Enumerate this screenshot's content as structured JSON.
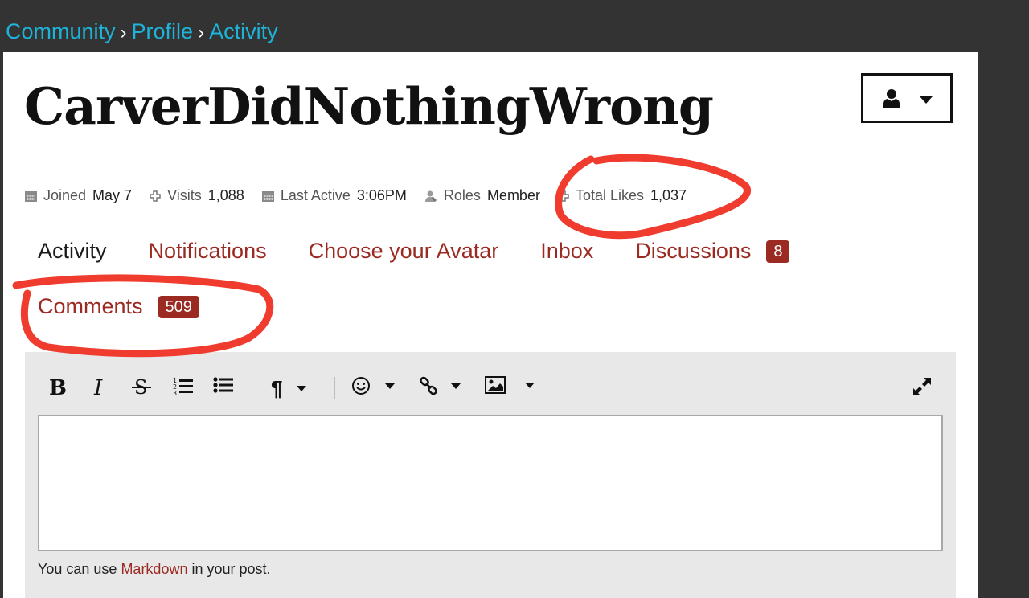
{
  "breadcrumb": {
    "items": [
      "Community",
      "Profile",
      "Activity"
    ],
    "separator": "›"
  },
  "profile": {
    "username": "CarverDidNothingWrong"
  },
  "user_menu": {
    "icon": "user-icon",
    "caret_icon": "caret-down-icon"
  },
  "meta": {
    "joined": {
      "label": "Joined",
      "value": "May 7"
    },
    "visits": {
      "label": "Visits",
      "value": "1,088"
    },
    "last_active": {
      "label": "Last Active",
      "value": "3:06PM"
    },
    "roles": {
      "label": "Roles",
      "value": "Member"
    },
    "total_likes": {
      "label": "Total Likes",
      "value": "1,037"
    }
  },
  "tabs": [
    {
      "label": "Activity",
      "active": true
    },
    {
      "label": "Notifications"
    },
    {
      "label": "Choose your Avatar"
    },
    {
      "label": "Inbox"
    },
    {
      "label": "Discussions",
      "count": "8"
    },
    {
      "label": "Comments",
      "count": "509"
    }
  ],
  "editor": {
    "toolbar": [
      "bold-icon",
      "italic-icon",
      "strikethrough-icon",
      "ordered-list-icon",
      "bullet-list-icon",
      "paragraph-icon",
      "emoji-icon",
      "link-icon",
      "image-icon",
      "fullscreen-icon"
    ],
    "hint_prefix": "You can use",
    "hint_link": "Markdown",
    "hint_suffix": "in your post."
  },
  "colors": {
    "background": "#333333",
    "breadcrumb_link": "#1eb3d8",
    "accent": "#9b2a22",
    "annotation": "#f03c2e"
  }
}
